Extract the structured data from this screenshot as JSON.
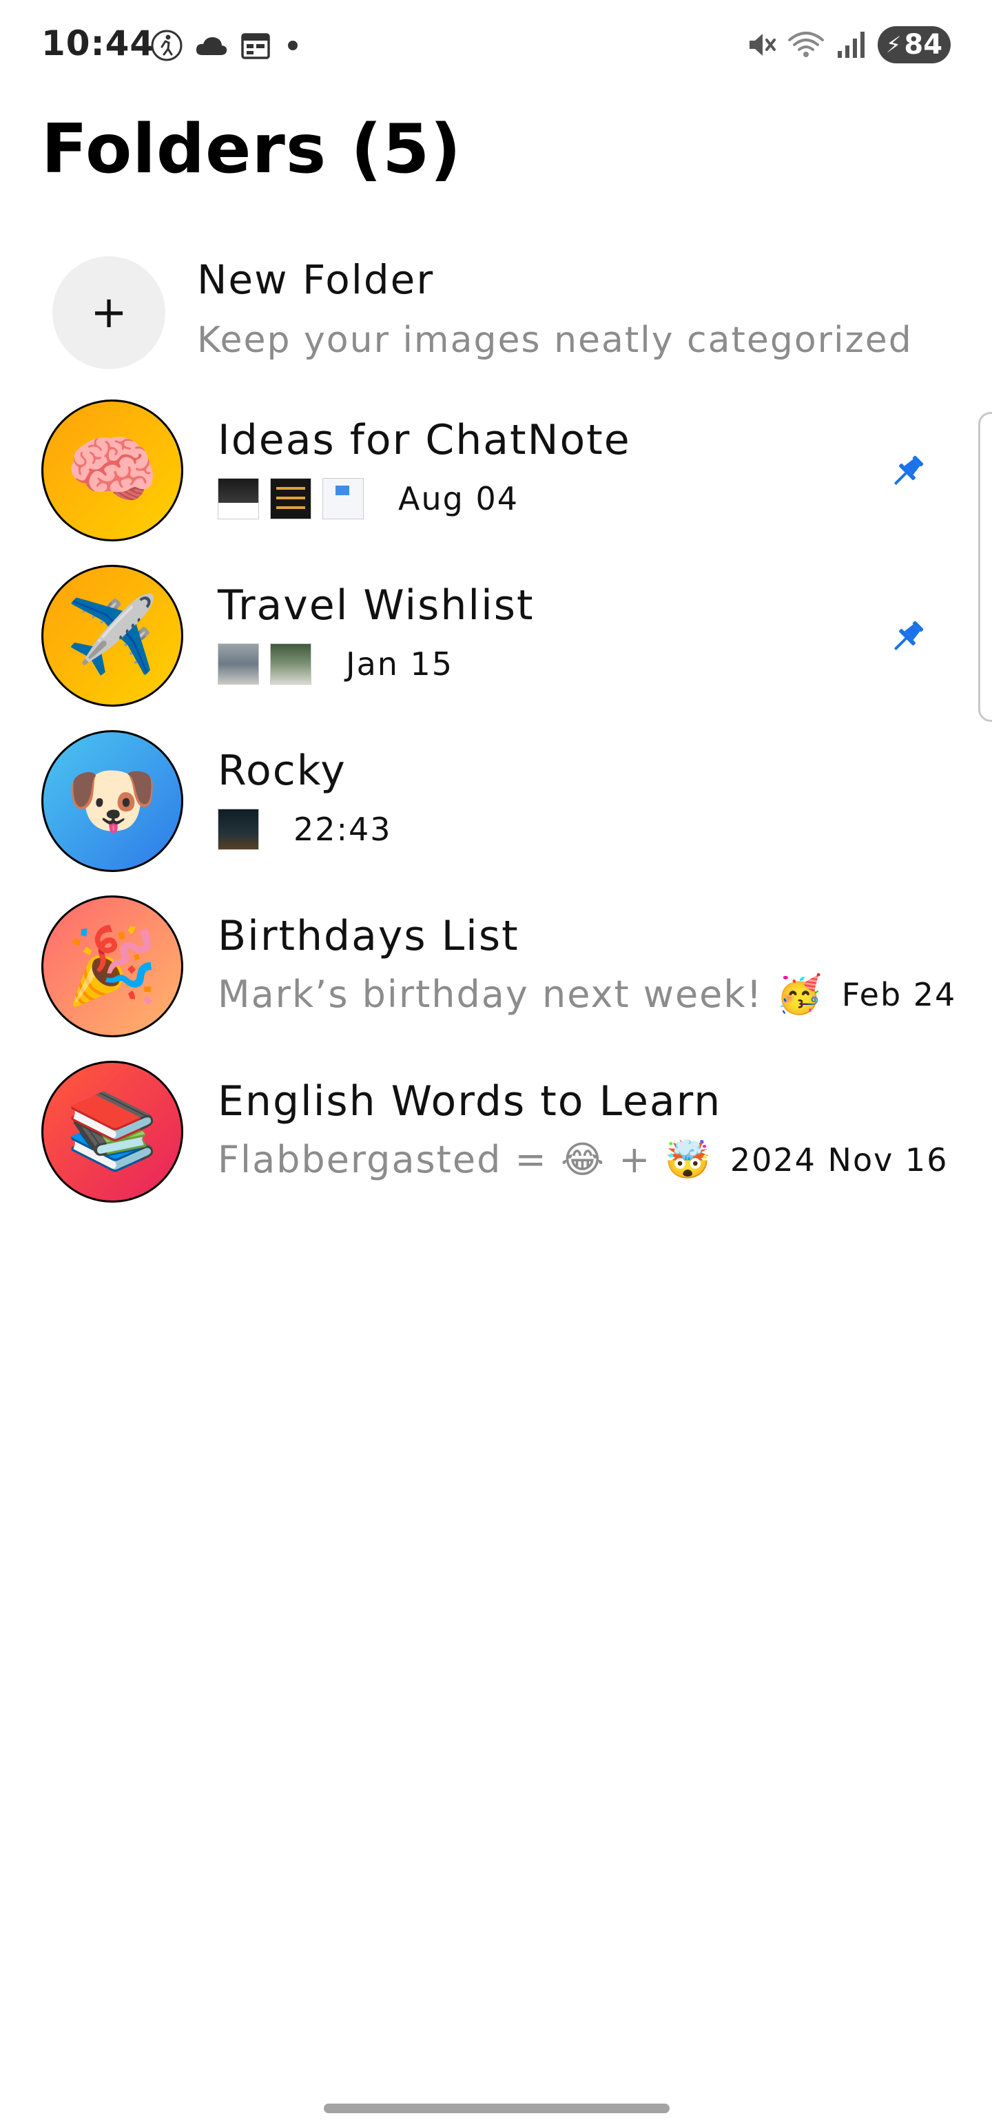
{
  "status_bar": {
    "time": "10:44",
    "left_icons": [
      "accessibility-icon",
      "cloud-icon",
      "calendar-icon",
      "dot-icon"
    ],
    "right_icons": [
      "mute-icon",
      "wifi-icon",
      "signal-icon"
    ],
    "battery": "84"
  },
  "page": {
    "title": "Folders (5)"
  },
  "new_folder": {
    "icon": "+",
    "title": "New Folder",
    "subtitle": "Keep your images neatly categorized"
  },
  "folders": [
    {
      "emoji": "🧠",
      "name": "Ideas for ChatNote",
      "date": "Aug 04",
      "pinned": true,
      "preview": ""
    },
    {
      "emoji": "✈️",
      "name": "Travel Wishlist",
      "date": "Jan 15",
      "pinned": true,
      "preview": ""
    },
    {
      "emoji": "🐶",
      "name": "Rocky",
      "date": "22:43",
      "pinned": false,
      "preview": ""
    },
    {
      "emoji": "🎉",
      "name": "Birthdays List",
      "date": "Feb 24",
      "pinned": false,
      "preview": "Mark’s birthday next week! 🥳"
    },
    {
      "emoji": "📚",
      "name": "English Words to Learn",
      "date": "2024 Nov 16",
      "pinned": false,
      "preview": "Flabbergasted = 😂 + 🤯"
    }
  ],
  "colors": {
    "pin_blue": "#1a73e8",
    "muted_text": "#8c8c8c",
    "new_folder_bg": "#efefef"
  }
}
